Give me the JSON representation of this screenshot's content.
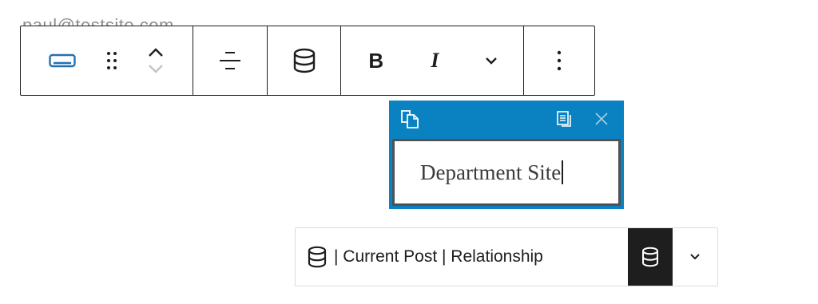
{
  "background": {
    "partial_text": "paul@testsite.com"
  },
  "toolbar": {
    "bold_label": "B",
    "italic_label": "I",
    "icons": [
      "button-block-icon",
      "drag-handle-icon",
      "chevron-up-icon",
      "chevron-down-icon",
      "align-icon",
      "database-icon",
      "chevron-down-icon",
      "more-vertical-icon"
    ]
  },
  "popover": {
    "field_value": "Department Site",
    "header_bg": "#0a82c2",
    "icons": [
      "copy-icon",
      "paste-icon",
      "close-icon"
    ]
  },
  "binding": {
    "label": "| Current Post | Relationship",
    "icons": [
      "database-icon",
      "database-icon",
      "chevron-down-icon"
    ]
  }
}
